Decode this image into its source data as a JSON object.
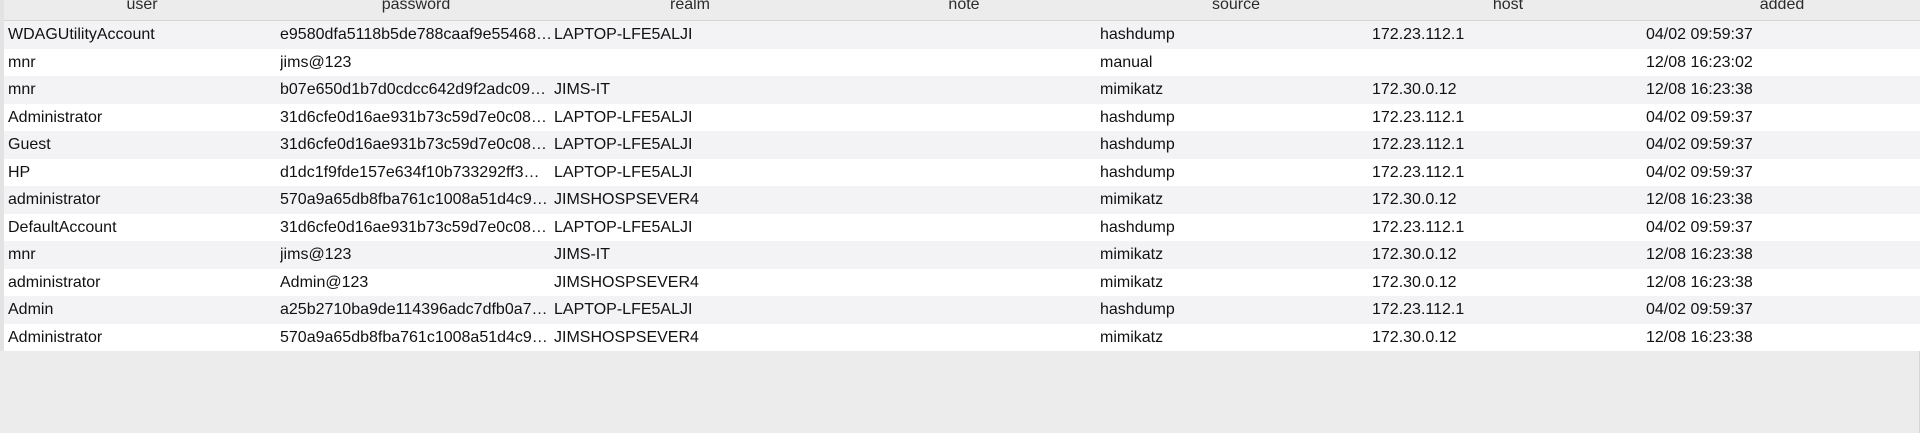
{
  "columns": {
    "user": "user",
    "password": "password",
    "realm": "realm",
    "note": "note",
    "source": "source",
    "host": "host",
    "added": "added"
  },
  "rows": [
    {
      "user": "WDAGUtilityAccount",
      "password": "e9580dfa5118b5de788caaf9e55468…",
      "realm": "LAPTOP-LFE5ALJI",
      "note": "",
      "source": "hashdump",
      "host": "172.23.112.1",
      "added": "04/02 09:59:37"
    },
    {
      "user": "mnr",
      "password": "jims@123",
      "realm": "",
      "note": "",
      "source": "manual",
      "host": "",
      "added": "12/08 16:23:02"
    },
    {
      "user": "mnr",
      "password": "b07e650d1b7d0cdcc642d9f2adc09…",
      "realm": "JIMS-IT",
      "note": "",
      "source": "mimikatz",
      "host": "172.30.0.12",
      "added": "12/08 16:23:38"
    },
    {
      "user": "Administrator",
      "password": "31d6cfe0d16ae931b73c59d7e0c08…",
      "realm": "LAPTOP-LFE5ALJI",
      "note": "",
      "source": "hashdump",
      "host": "172.23.112.1",
      "added": "04/02 09:59:37"
    },
    {
      "user": "Guest",
      "password": "31d6cfe0d16ae931b73c59d7e0c08…",
      "realm": "LAPTOP-LFE5ALJI",
      "note": "",
      "source": "hashdump",
      "host": "172.23.112.1",
      "added": "04/02 09:59:37"
    },
    {
      "user": "HP",
      "password": "d1dc1f9fde157e634f10b733292ff3…",
      "realm": "LAPTOP-LFE5ALJI",
      "note": "",
      "source": "hashdump",
      "host": "172.23.112.1",
      "added": "04/02 09:59:37"
    },
    {
      "user": "administrator",
      "password": "570a9a65db8fba761c1008a51d4c9…",
      "realm": "JIMSHOSPSEVER4",
      "note": "",
      "source": "mimikatz",
      "host": "172.30.0.12",
      "added": "12/08 16:23:38"
    },
    {
      "user": "DefaultAccount",
      "password": "31d6cfe0d16ae931b73c59d7e0c08…",
      "realm": "LAPTOP-LFE5ALJI",
      "note": "",
      "source": "hashdump",
      "host": "172.23.112.1",
      "added": "04/02 09:59:37"
    },
    {
      "user": "mnr",
      "password": "jims@123",
      "realm": "JIMS-IT",
      "note": "",
      "source": "mimikatz",
      "host": "172.30.0.12",
      "added": "12/08 16:23:38"
    },
    {
      "user": "administrator",
      "password": "Admin@123",
      "realm": "JIMSHOSPSEVER4",
      "note": "",
      "source": "mimikatz",
      "host": "172.30.0.12",
      "added": "12/08 16:23:38"
    },
    {
      "user": "Admin",
      "password": "a25b2710ba9de114396adc7dfb0a7…",
      "realm": "LAPTOP-LFE5ALJI",
      "note": "",
      "source": "hashdump",
      "host": "172.23.112.1",
      "added": "04/02 09:59:37"
    },
    {
      "user": "Administrator",
      "password": "570a9a65db8fba761c1008a51d4c9…",
      "realm": "JIMSHOSPSEVER4",
      "note": "",
      "source": "mimikatz",
      "host": "172.30.0.12",
      "added": "12/08 16:23:38"
    }
  ]
}
